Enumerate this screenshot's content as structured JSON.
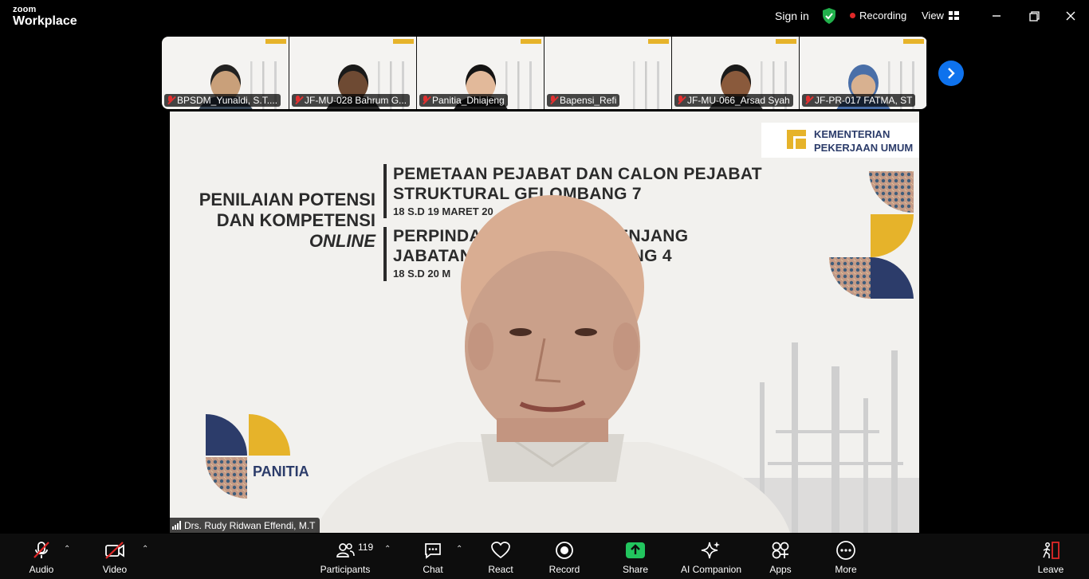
{
  "app": {
    "logo_small": "zoom",
    "logo_large": "Workplace"
  },
  "header": {
    "signin": "Sign in",
    "recording": "Recording",
    "view": "View"
  },
  "thumbnails": [
    {
      "name": "BPSDM_Yunaldi, S.T....",
      "skin": "#c9a07a",
      "shirt": "#3b4a5a",
      "hair": "#222"
    },
    {
      "name": "JF-MU-028 Bahrum G...",
      "skin": "#6e4a33",
      "shirt": "#2a2a2a",
      "hair": "#1a1a1a"
    },
    {
      "name": "Panitia_Dhiajeng",
      "skin": "#e2b99a",
      "shirt": "#1e1e1e",
      "hair": "#141414"
    },
    {
      "name": "Bapensi_Refi",
      "skin": "",
      "shirt": "",
      "hair": ""
    },
    {
      "name": "JF-MU-066_Arsad Syah",
      "skin": "#8a5a3c",
      "shirt": "#3a3a3a",
      "hair": "#1a1a1a"
    },
    {
      "name": "JF-PR-017 FATMA, ST",
      "skin": "#d8b190",
      "shirt": "#4a6fa8",
      "hair": "#4a6fa8"
    }
  ],
  "slide": {
    "left_line1": "PENILAIAN POTENSI",
    "left_line2": "DAN KOMPETENSI",
    "left_line3": "ONLINE",
    "title1_line1": "PEMETAAN PEJABAT DAN CALON PEJABAT",
    "title1_line2": "STRUKTURAL GELOMBANG 7",
    "date1": "18 S.D 19 MARET 20",
    "title2_line1": "PERPINDA                    AN JENJANG",
    "title2_line2": "JABATAN                      OMBANG 4",
    "date2": "18 S.D 20 M",
    "logo_line1": "KEMENTERIAN",
    "logo_line2": "PEKERJAAN UMUM",
    "panitia": "PANITIA"
  },
  "main_video": {
    "name": "Drs. Rudy Ridwan Effendi, M.T"
  },
  "toolbar": {
    "audio": "Audio",
    "video": "Video",
    "participants": "Participants",
    "participants_count": "119",
    "chat": "Chat",
    "react": "React",
    "record": "Record",
    "share": "Share",
    "ai": "AI Companion",
    "apps": "Apps",
    "more": "More",
    "leave": "Leave"
  },
  "colors": {
    "accent_blue": "#0e72ed",
    "share_green": "#22c55e",
    "record_red": "#e02828",
    "brand_navy": "#2c3c6a",
    "brand_gold": "#e6b32a"
  }
}
